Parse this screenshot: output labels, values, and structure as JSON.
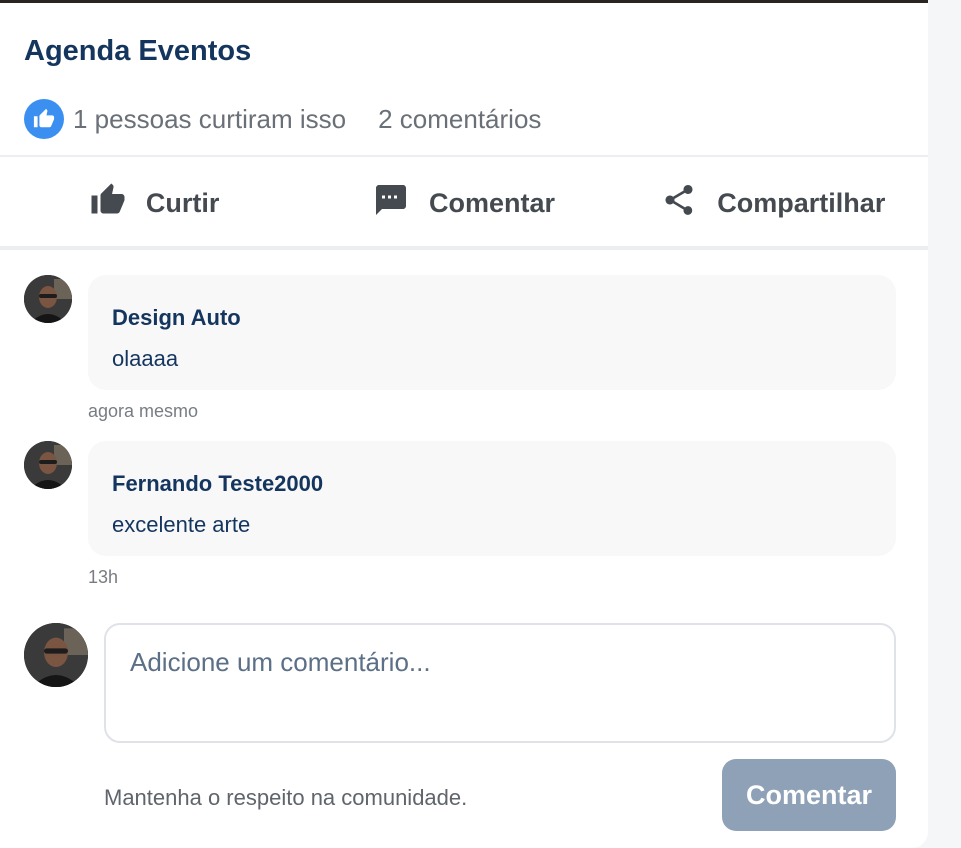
{
  "post": {
    "title": "Agenda Eventos",
    "likes_text": "1 pessoas curtiram isso",
    "comments_count_text": "2 comentários"
  },
  "actions": {
    "like_label": "Curtir",
    "comment_label": "Comentar",
    "share_label": "Compartilhar"
  },
  "comments": [
    {
      "author": "Design Auto",
      "text": "olaaaa",
      "time": "agora mesmo"
    },
    {
      "author": "Fernando Teste2000",
      "text": "excelente arte",
      "time": "13h"
    }
  ],
  "composer": {
    "placeholder": "Adicione um comentário...",
    "notice": "Mantenha o respeito na comunidade.",
    "submit_label": "Comentar"
  },
  "colors": {
    "accent": "#3b8ff0",
    "title": "#14355e",
    "button_disabled": "#8ea1b7"
  },
  "icons": {
    "like": "thumbs-up-icon",
    "comment": "chat-bubble-icon",
    "share": "share-icon"
  }
}
